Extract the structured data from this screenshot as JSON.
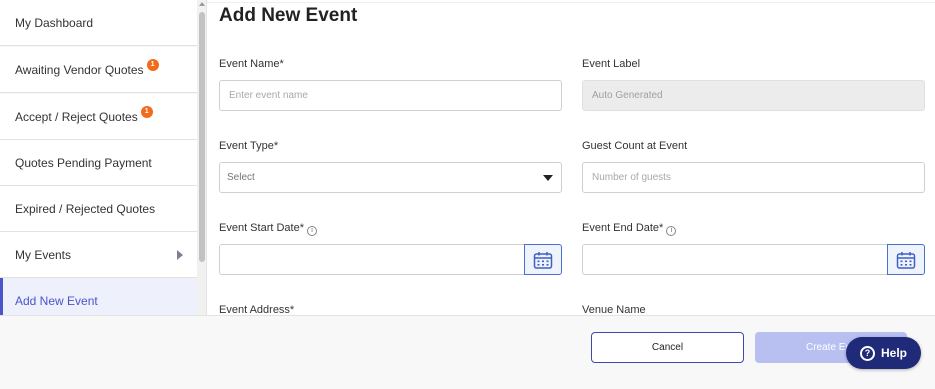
{
  "sidebar": {
    "items": [
      {
        "label": "My Dashboard"
      },
      {
        "label": "Awaiting Vendor Quotes",
        "badge": "1"
      },
      {
        "label": "Accept / Reject Quotes",
        "badge": "1"
      },
      {
        "label": "Quotes Pending Payment"
      },
      {
        "label": "Expired / Rejected Quotes"
      },
      {
        "label": "My Events"
      },
      {
        "label": "Add New Event"
      }
    ],
    "active_index": 6
  },
  "form": {
    "title": "Add New Event",
    "event_name": {
      "label": "Event Name*",
      "placeholder": "Enter event name",
      "value": ""
    },
    "event_label": {
      "label": "Event Label",
      "placeholder": "Auto Generated",
      "value": ""
    },
    "event_type": {
      "label": "Event Type*",
      "selected": "Select"
    },
    "guest_count": {
      "label": "Guest Count at Event",
      "placeholder": "Number of guests",
      "value": ""
    },
    "start_date": {
      "label": "Event Start Date*",
      "info_icon": "i",
      "value": ""
    },
    "end_date": {
      "label": "Event End Date*",
      "info_icon": "i",
      "value": ""
    },
    "event_address": {
      "label": "Event Address*"
    },
    "venue_name": {
      "label": "Venue Name"
    }
  },
  "footer": {
    "cancel_label": "Cancel",
    "create_label": "Create Eve",
    "help_label": "Help",
    "help_icon": "?"
  },
  "colors": {
    "accent": "#4a55c8",
    "badge": "#f26b1d",
    "help_button": "#1f2a78",
    "create_button_disabled": "#b8c0f2"
  }
}
